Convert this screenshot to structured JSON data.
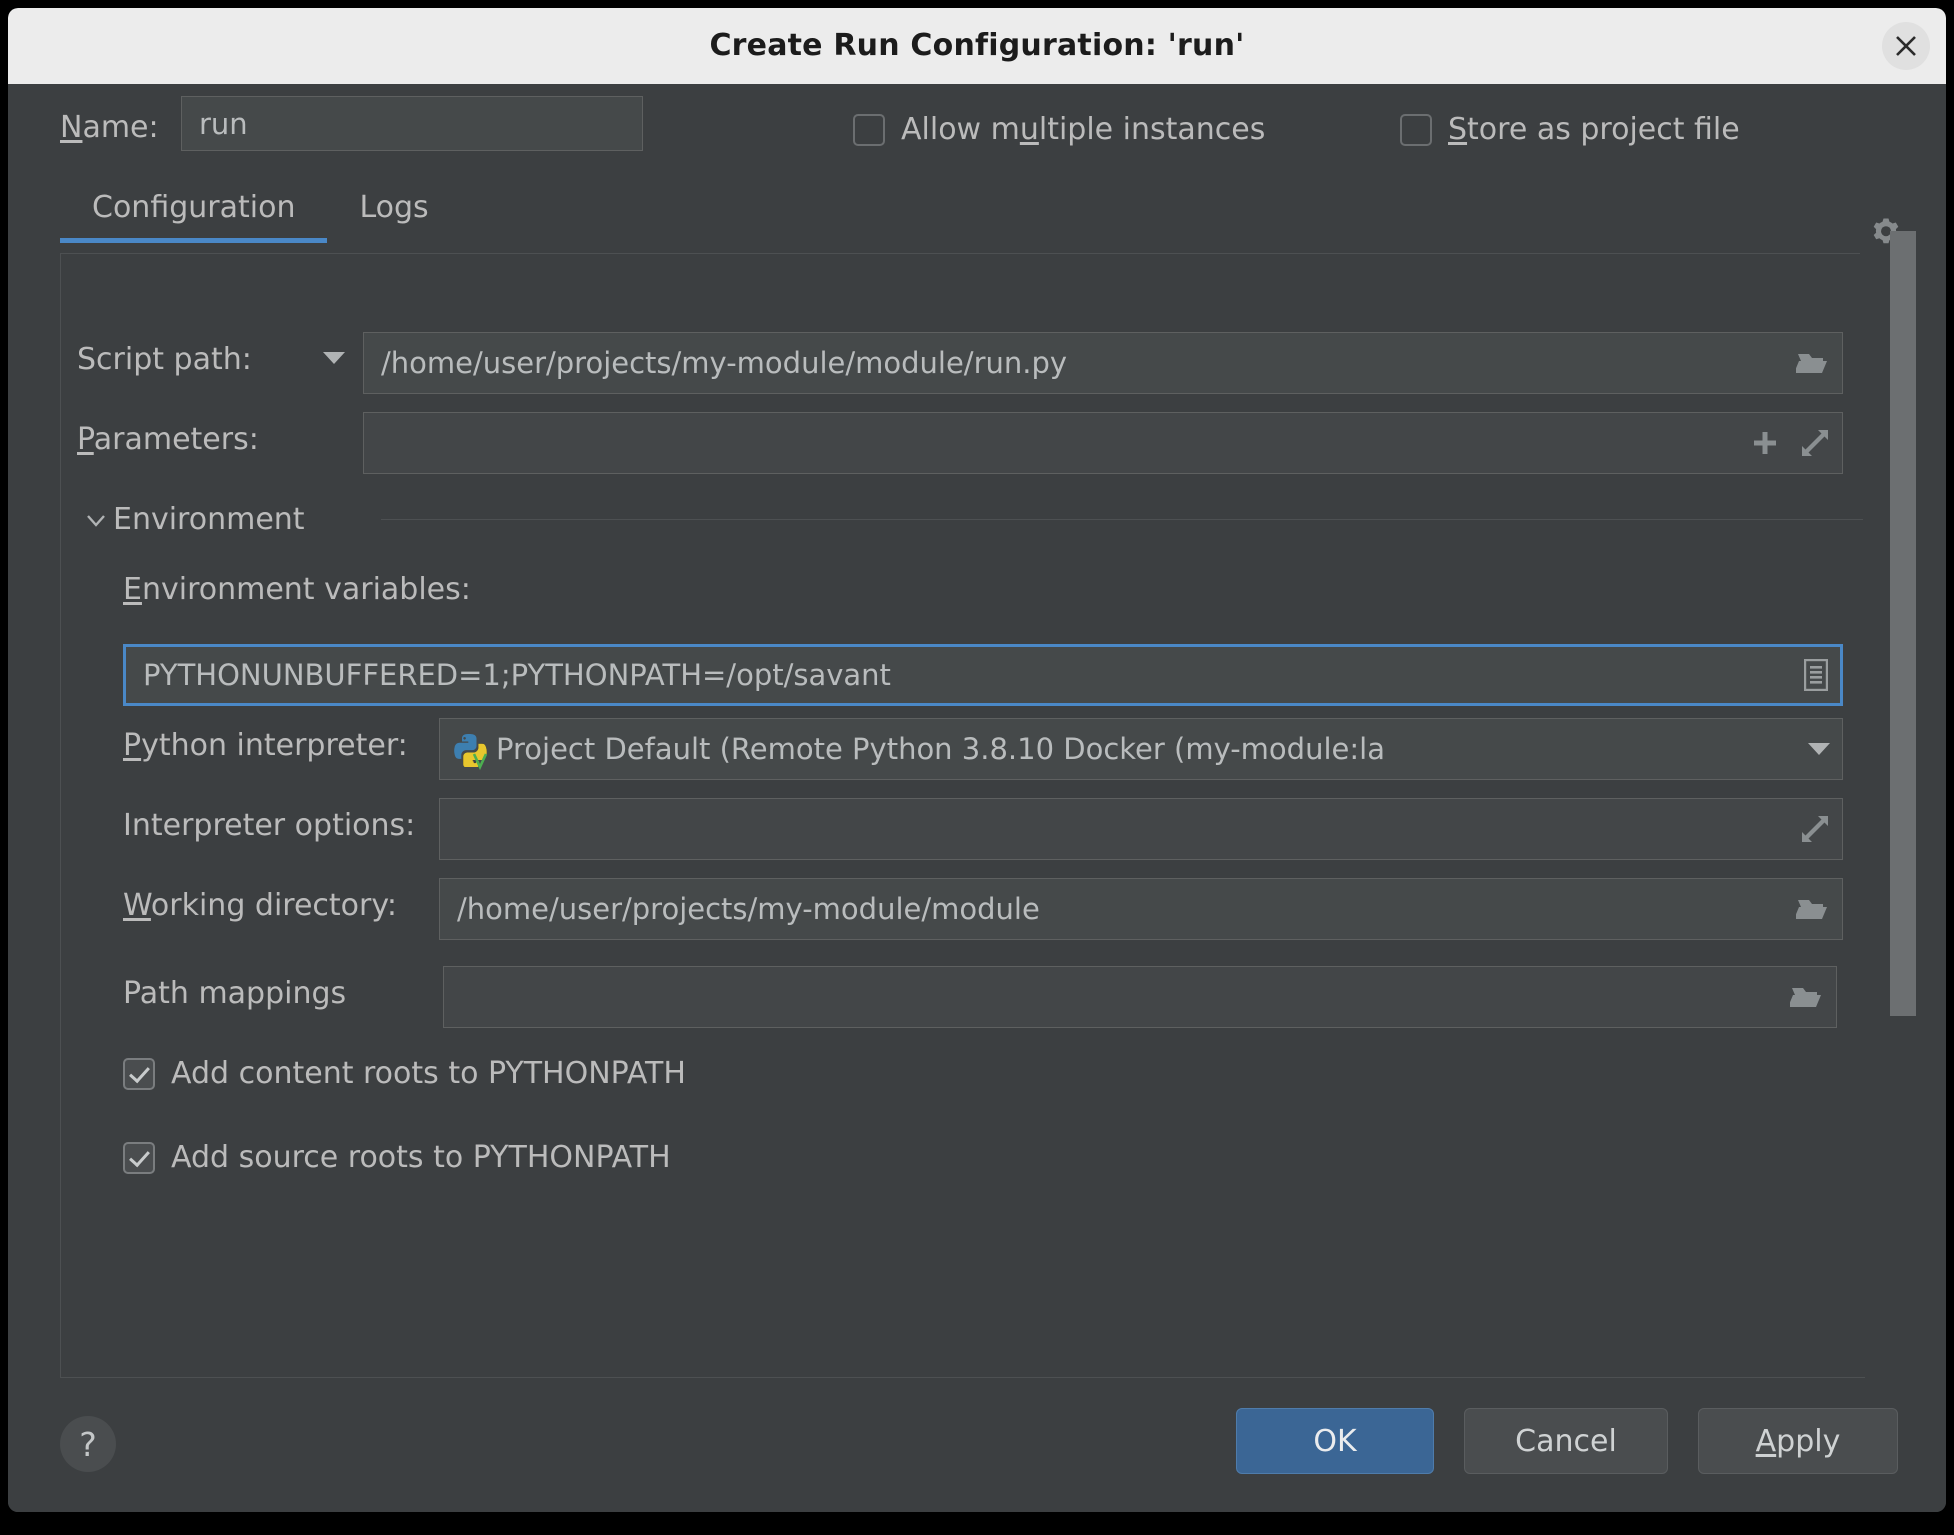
{
  "window": {
    "title": "Create Run Configuration: 'run'",
    "close_icon": "close-icon"
  },
  "header": {
    "name_label": "Name:",
    "name_label_mnemonic": "N",
    "name_value": "run",
    "allow_multiple_instances": {
      "label": "Allow multiple instances",
      "checked": false,
      "mnemonic": "u"
    },
    "store_as_project_file": {
      "label": "Store as project file",
      "checked": false,
      "mnemonic": "S"
    },
    "gear_icon": "gear-dropdown-icon"
  },
  "tabs": [
    {
      "label": "Configuration",
      "active": true
    },
    {
      "label": "Logs",
      "active": false
    }
  ],
  "form": {
    "script_path": {
      "label": "Script path:",
      "value": "/home/user/projects/my-module/module/run.py",
      "icon": "folder-icon",
      "has_dropdown": true
    },
    "parameters": {
      "label": "Parameters:",
      "value": "",
      "mnemonic": "P",
      "icons": [
        "plus-icon",
        "expand-icon"
      ]
    },
    "environment_section": {
      "label": "Environment",
      "expanded": true,
      "collapse_icon": "chevron-down-icon"
    },
    "environment_variables": {
      "label": "Environment variables:",
      "mnemonic": "E",
      "value": "PYTHONUNBUFFERED=1;PYTHONPATH=/opt/savant",
      "focused": true,
      "icon": "browse-list-icon"
    },
    "python_interpreter": {
      "label": "Python interpreter:",
      "mnemonic": "P",
      "value": "Project Default (Remote Python 3.8.10 Docker (my-module:la",
      "icon": "python-venv-icon",
      "has_dropdown": true
    },
    "interpreter_options": {
      "label": "Interpreter options:",
      "value": "",
      "icons": [
        "expand-icon"
      ]
    },
    "working_directory": {
      "label": "Working directory:",
      "mnemonic": "W",
      "value": "/home/user/projects/my-module/module",
      "icon": "folder-icon"
    },
    "path_mappings": {
      "label": "Path mappings",
      "value": "",
      "icon": "folder-icon"
    },
    "add_content_roots": {
      "label": "Add content roots to PYTHONPATH",
      "checked": true
    },
    "add_source_roots": {
      "label": "Add source roots to PYTHONPATH",
      "checked": true
    }
  },
  "footer": {
    "help_label": "?",
    "ok_label": "OK",
    "cancel_label": "Cancel",
    "apply_label": "Apply",
    "apply_mnemonic": "A"
  },
  "colors": {
    "accent": "#4a88c7",
    "dialog_bg": "#3c3f41",
    "field_bg": "#45494a",
    "titlebar_bg": "#ececec",
    "default_button": "#3b6695",
    "text": "#bbbbbb"
  }
}
